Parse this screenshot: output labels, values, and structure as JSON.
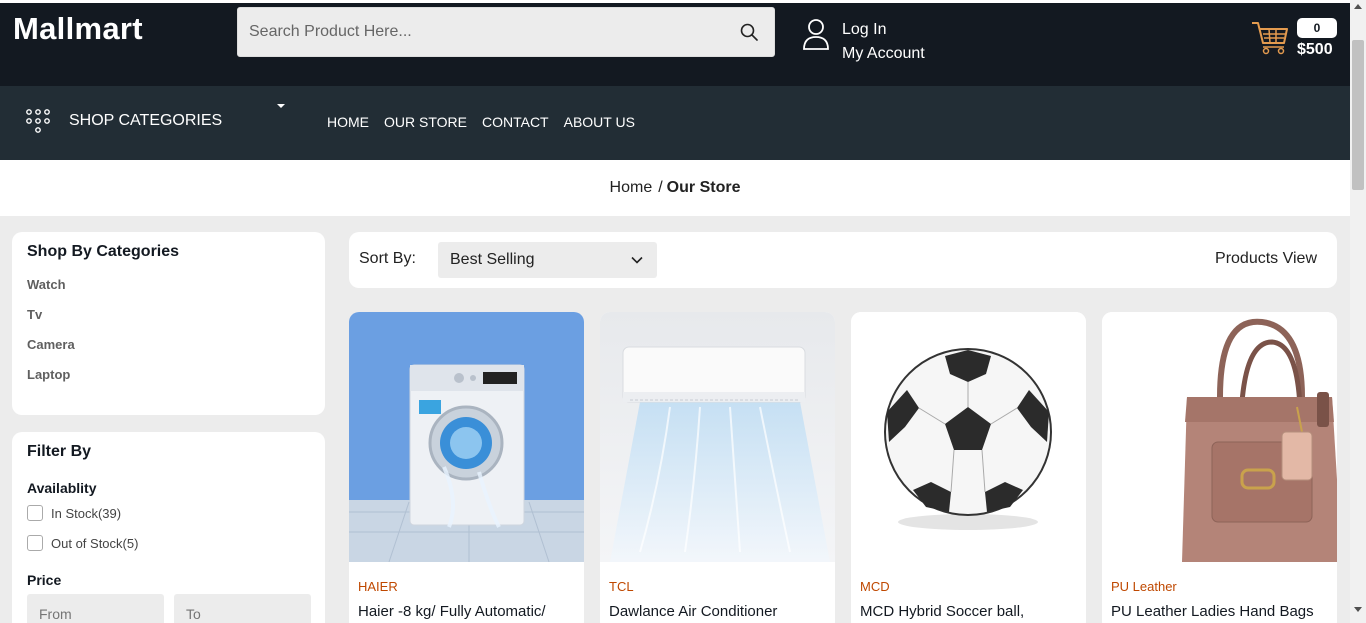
{
  "header": {
    "logo": "Mallmart",
    "search_placeholder": "Search Product Here...",
    "login_label": "Log In",
    "account_label": "My Account",
    "cart_count": "0",
    "cart_total": "$500"
  },
  "nav": {
    "categories_label": "SHOP CATEGORIES",
    "links": [
      "HOME",
      "OUR STORE",
      "CONTACT",
      "ABOUT US"
    ]
  },
  "breadcrumb": {
    "home": "Home",
    "separator": "/",
    "current": "Our Store"
  },
  "sidebar": {
    "categories_title": "Shop By Categories",
    "categories": [
      "Watch",
      "Tv",
      "Camera",
      "Laptop"
    ],
    "filter_title": "Filter By",
    "availability_label": "Availablity",
    "in_stock": "In Stock(39)",
    "out_of_stock": "Out of Stock(5)",
    "price_label": "Price",
    "price_from_placeholder": "From",
    "price_to_placeholder": "To"
  },
  "sort": {
    "label": "Sort By:",
    "selected": "Best Selling",
    "products_view": "Products View"
  },
  "products": [
    {
      "brand": "HAIER",
      "title": "Haier -8 kg/ Fully Automatic/",
      "image": "washing-machine-image"
    },
    {
      "brand": "TCL",
      "title": "Dawlance Air Conditioner",
      "image": "air-conditioner-image"
    },
    {
      "brand": "MCD",
      "title": "MCD Hybrid Soccer ball,",
      "image": "soccer-ball-image"
    },
    {
      "brand": "PU Leather",
      "title": "PU Leather Ladies Hand Bags",
      "image": "handbag-image"
    }
  ],
  "colors": {
    "topbar": "#131921",
    "navbar": "#222d35",
    "brand_text": "#bf4800",
    "page_bg": "#ececec"
  }
}
